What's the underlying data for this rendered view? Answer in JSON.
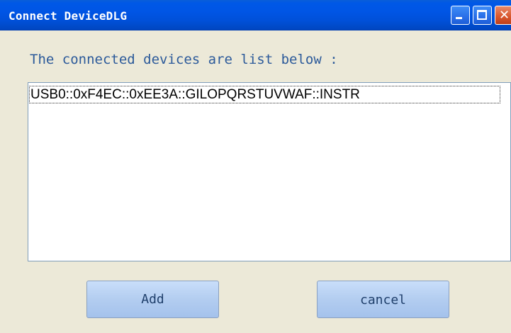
{
  "window": {
    "title": "Connect DeviceDLG"
  },
  "icons": {
    "minimize": "minimize-icon",
    "maximize": "maximize-icon",
    "close": "close-icon"
  },
  "dialog": {
    "prompt": "The connected devices are list below :",
    "devices": [
      "USB0::0xF4EC::0xEE3A::GILOPQRSTUVWAF::INSTR"
    ],
    "add_label": "Add",
    "cancel_label": "cancel"
  },
  "colors": {
    "titlebar": "#0055e5",
    "background": "#ece9d8",
    "prompt_text": "#2c5a9a",
    "button_face": "#b3cdf0"
  }
}
